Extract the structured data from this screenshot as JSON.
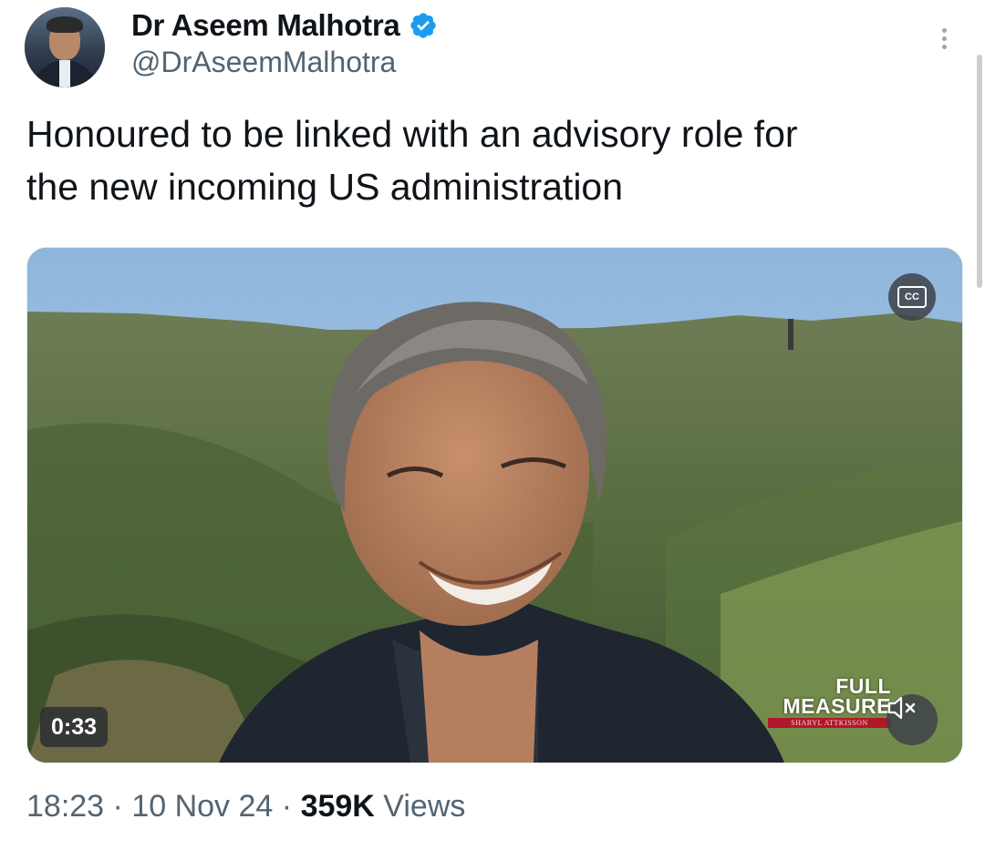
{
  "author": {
    "name": "Dr Aseem Malhotra",
    "handle": "@DrAseemMalhotra",
    "verified": true,
    "avatar_icon": "profile-photo-icon"
  },
  "tweet": {
    "text": "Honoured to be linked with an advisory role for\nthe new incoming US administration"
  },
  "video": {
    "duration": "0:33",
    "cc_label": "CC",
    "logo_line1": "FULL",
    "logo_line2": "MEASURE",
    "logo_line3": "SHARYL ATTKISSON",
    "muted": true
  },
  "meta": {
    "time": "18:23",
    "separator": "·",
    "date": "10 Nov 24",
    "views_count": "359K",
    "views_label": "Views"
  },
  "colors": {
    "verified": "#1d9bf0",
    "text_primary": "#0f1419",
    "text_secondary": "#536471"
  }
}
